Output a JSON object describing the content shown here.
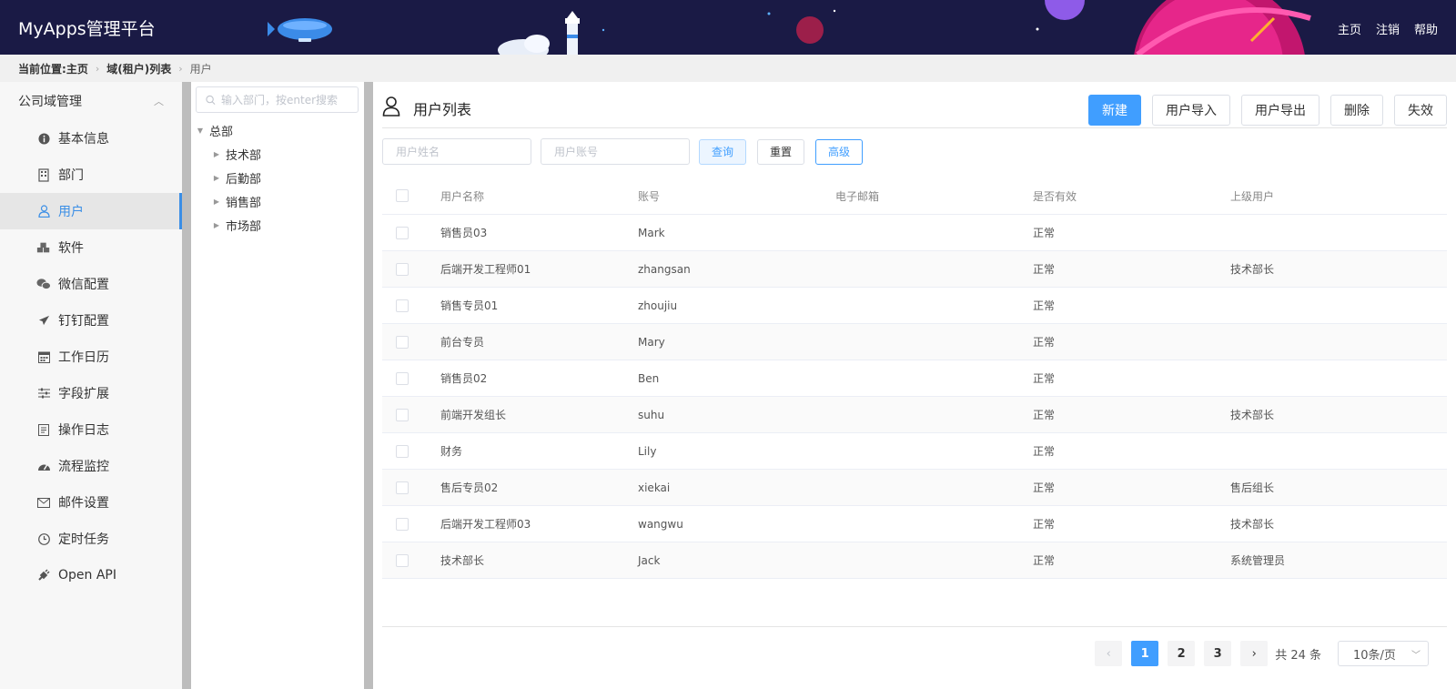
{
  "header": {
    "title": "MyApps管理平台",
    "nav": [
      "主页",
      "注销",
      "帮助"
    ]
  },
  "breadcrumb": {
    "label": "当前位置:",
    "items": [
      "主页",
      "域(租户)列表",
      "用户"
    ]
  },
  "sidebar": {
    "section_title": "公司域管理",
    "items": [
      {
        "label": "基本信息",
        "icon": "info-icon"
      },
      {
        "label": "部门",
        "icon": "building-icon"
      },
      {
        "label": "用户",
        "icon": "user-icon"
      },
      {
        "label": "软件",
        "icon": "cubes-icon"
      },
      {
        "label": "微信配置",
        "icon": "wechat-icon"
      },
      {
        "label": "钉钉配置",
        "icon": "plane-icon"
      },
      {
        "label": "工作日历",
        "icon": "calendar-icon"
      },
      {
        "label": "字段扩展",
        "icon": "sliders-icon"
      },
      {
        "label": "操作日志",
        "icon": "log-icon"
      },
      {
        "label": "流程监控",
        "icon": "dashboard-icon"
      },
      {
        "label": "邮件设置",
        "icon": "mail-icon"
      },
      {
        "label": "定时任务",
        "icon": "clock-icon"
      },
      {
        "label": "Open API",
        "icon": "plug-icon"
      }
    ],
    "active": "用户"
  },
  "tree": {
    "search_placeholder": "输入部门，按enter搜索",
    "root": "总部",
    "children": [
      "技术部",
      "后勤部",
      "销售部",
      "市场部"
    ]
  },
  "main": {
    "title": "用户列表",
    "actions": [
      "新建",
      "用户导入",
      "用户导出",
      "删除",
      "失效"
    ],
    "filters": {
      "name_placeholder": "用户姓名",
      "account_placeholder": "用户账号",
      "query": "查询",
      "reset": "重置",
      "advanced": "高级"
    },
    "columns": [
      "用户名称",
      "账号",
      "电子邮箱",
      "是否有效",
      "上级用户"
    ],
    "rows": [
      {
        "name": "销售员03",
        "account": "Mark",
        "email": "",
        "status": "正常",
        "superior": ""
      },
      {
        "name": "后端开发工程师01",
        "account": "zhangsan",
        "email": "",
        "status": "正常",
        "superior": "技术部长"
      },
      {
        "name": "销售专员01",
        "account": "zhoujiu",
        "email": "",
        "status": "正常",
        "superior": ""
      },
      {
        "name": "前台专员",
        "account": "Mary",
        "email": "",
        "status": "正常",
        "superior": ""
      },
      {
        "name": "销售员02",
        "account": "Ben",
        "email": "",
        "status": "正常",
        "superior": ""
      },
      {
        "name": "前端开发组长",
        "account": "suhu",
        "email": "",
        "status": "正常",
        "superior": "技术部长"
      },
      {
        "name": "财务",
        "account": "Lily",
        "email": "",
        "status": "正常",
        "superior": ""
      },
      {
        "name": "售后专员02",
        "account": "xiekai",
        "email": "",
        "status": "正常",
        "superior": "售后组长"
      },
      {
        "name": "后端开发工程师03",
        "account": "wangwu",
        "email": "",
        "status": "正常",
        "superior": "技术部长"
      },
      {
        "name": "技术部长",
        "account": "Jack",
        "email": "",
        "status": "正常",
        "superior": "系统管理员"
      }
    ]
  },
  "pagination": {
    "pages": [
      "1",
      "2",
      "3"
    ],
    "current": "1",
    "total_text": "共 24 条",
    "page_size": "10条/页"
  },
  "colors": {
    "header_bg": "#1a1a45",
    "primary": "#409eff",
    "active_nav": "#3a8ee6"
  }
}
